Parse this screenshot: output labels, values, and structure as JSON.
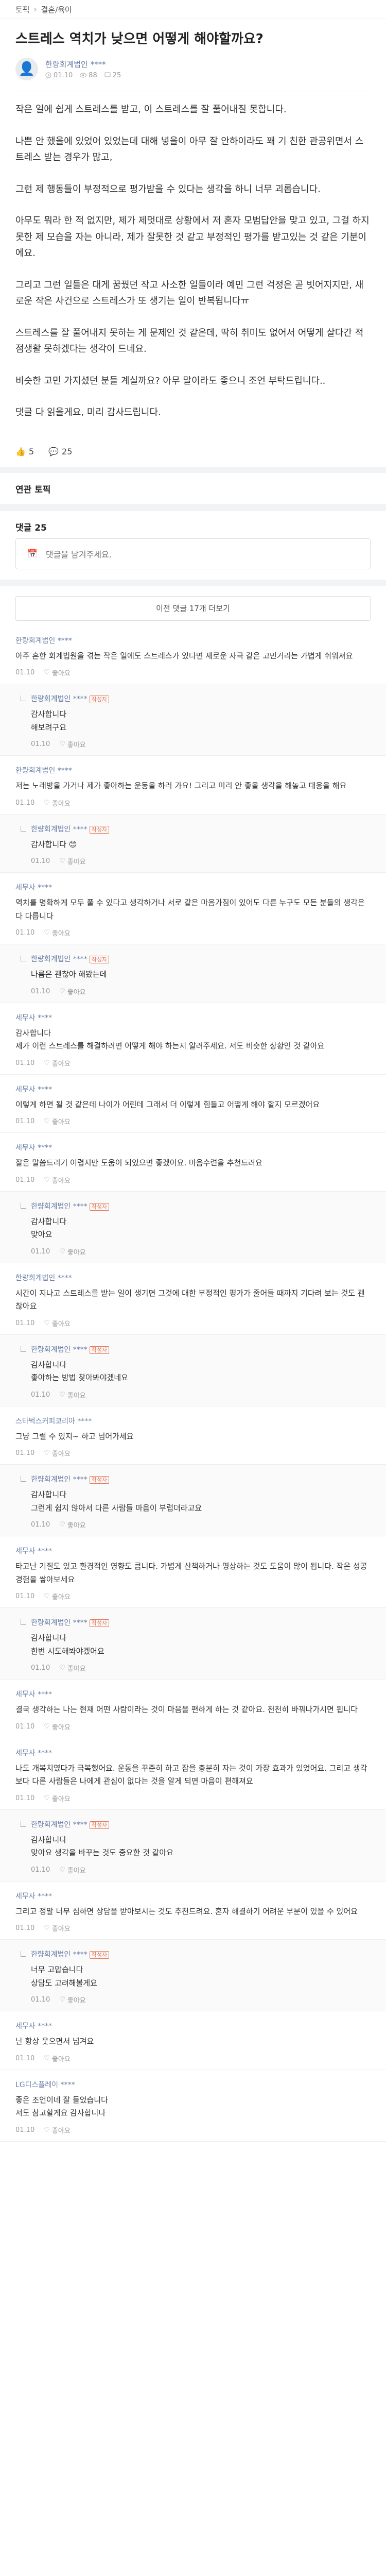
{
  "breadcrumb": [
    "토픽",
    "결혼/육아"
  ],
  "post": {
    "title": "스트레스 역치가 낮으면 어떻게 해야할까요?",
    "author": "한량회계법인 ****",
    "date": "01.10",
    "views": "88",
    "comments_count": "25",
    "body": [
      "작은 일에 쉽게 스트레스를 받고, 이 스트레스를 잘 풀어내질 못합니다.",
      "나쁜 안 했을에 있었어 있었는데 대해 넣을이 아무 잘 안하이라도 꽤 기 친한 관공위면서 스트레스 받는 경우가 많고,",
      "그런 제 행동들이 부정적으로 평가받을 수 있다는 생각을 하니 너무 괴롭습니다.",
      "아무도 뭐라 한 적 없지만, 제가 제멋대로 상황에서 저 혼자 모범답안을 맞고 있고, 그걸 하지 못한 제 모습을 자는 아니라, 제가 잘못한 것 같고 부정적인 평가를 받고있는 것 같은 기분이에요.",
      "그리고 그런 일들은 대게 꿈꿨던 작고 사소한 일들이라 예민 그런 걱정은 곧 빗어지지만, 새로운 작은 사건으로 스트레스가 또 생기는 일이 반복됩니다ㅠ",
      "스트레스를 잘 풀어내지 못하는 게 문제인 것 같은데, 딱히 취미도 없어서 어떻게 살다간 적점생활 못하겠다는 생각이 드네요.",
      "비슷한 고민 가지셨던 분들 계실까요? 아무 말이라도 좋으니 조언 부탁드립니다..",
      "댓글 다 읽을게요, 미리 감사드립니다."
    ],
    "likes": "5",
    "comments_label": "25"
  },
  "sections": {
    "related_label": "연관 토픽",
    "comments_header": "댓글 25",
    "comment_placeholder": "댓글을 남겨주세요.",
    "load_older": "이전 댓글 17개 더보기"
  },
  "comments": [
    {
      "name": "한량회계법인 ****",
      "badge": "",
      "reply": false,
      "text": "아주 흔한 회계법원을 겪는 작은 일에도 스트레스가 있다면 새로운 자극 같은 고민거리는 가볍게 쉬워져요",
      "date": "01.10",
      "likes": "좋아요"
    },
    {
      "name": "한량회계법인 ****",
      "badge": "작성자",
      "reply": true,
      "text": "감사합니다\n해보려구요",
      "date": "01.10",
      "likes": "좋아요"
    },
    {
      "name": "한량회계법인 ****",
      "badge": "",
      "reply": false,
      "text": "저는 노래방을 가거나 제가 좋아하는 운동을 하러 가요! 그리고 미리 안 좋을 생각을 해놓고 대응을 해요",
      "date": "01.10",
      "likes": "좋아요"
    },
    {
      "name": "한량회계법인 ****",
      "badge": "작성자",
      "reply": true,
      "text": "감사합니다 😊",
      "date": "01.10",
      "likes": "좋아요"
    },
    {
      "name": "세무사 ****",
      "badge": "",
      "reply": false,
      "text": "역치를 명확하게 모두 풀 수 있다고 생각하거나 서로 같은 마음가짐이 있어도 다른 누구도 모든 분들의 생각은 다 다릅니다",
      "date": "01.10",
      "likes": "좋아요"
    },
    {
      "name": "한량회계법인 ****",
      "badge": "작성자",
      "reply": true,
      "text": "나름은 괜찮아 해봤는데",
      "date": "01.10",
      "likes": "좋아요"
    },
    {
      "name": "세무사 ****",
      "badge": "",
      "reply": false,
      "text": "감사합니다\n제가 이런 스트레스를 해결하려면 어떻게 해야 하는지 알려주세요. 저도 비슷한 상황인 것 같아요",
      "date": "01.10",
      "likes": "좋아요"
    },
    {
      "name": "세무사 ****",
      "badge": "",
      "reply": false,
      "text": "이렇게 하면 될 것 같은데 나이가 어린데 그래서 더 이렇게 힘들고 어떻게 해야 할지 모르겠어요",
      "date": "01.10",
      "likes": "좋아요"
    },
    {
      "name": "세무사 ****",
      "badge": "",
      "reply": false,
      "text": "잘은 말씀드리기 어렵지만 도움이 되었으면 좋겠어요. 마음수련을 추천드려요",
      "date": "01.10",
      "likes": "좋아요"
    },
    {
      "name": "한량회계법인 ****",
      "badge": "작성자",
      "reply": true,
      "text": "감사합니다\n맞아요",
      "date": "01.10",
      "likes": "좋아요"
    },
    {
      "name": "한량회계법인 ****",
      "badge": "",
      "reply": false,
      "text": "시간이 지나고 스트레스를 받는 일이 생기면 그것에 대한 부정적인 평가가 줄어들 때까지 기다려 보는 것도 괜찮아요",
      "date": "01.10",
      "likes": "좋아요"
    },
    {
      "name": "한량회계법인 ****",
      "badge": "작성자",
      "reply": true,
      "text": "감사합니다\n좋아하는 방법 찾아봐야겠네요",
      "date": "01.10",
      "likes": "좋아요"
    },
    {
      "name": "스타벅스커피코리아 ****",
      "badge": "",
      "reply": false,
      "text": "그냥 그럴 수 있지~ 하고 넘어가세요",
      "date": "01.10",
      "likes": "좋아요"
    },
    {
      "name": "한량회계법인 ****",
      "badge": "작성자",
      "reply": true,
      "text": "감사합니다\n그런게 쉽지 않아서 다른 사람들 마음이 부럽더라고요",
      "date": "01.10",
      "likes": "좋아요"
    },
    {
      "name": "세무사 ****",
      "badge": "",
      "reply": false,
      "text": "타고난 기질도 있고 환경적인 영향도 큽니다. 가볍게 산책하거나 명상하는 것도 도움이 많이 됩니다. 작은 성공 경험을 쌓아보세요",
      "date": "01.10",
      "likes": "좋아요"
    },
    {
      "name": "한량회계법인 ****",
      "badge": "작성자",
      "reply": true,
      "text": "감사합니다\n한번 시도해봐야겠어요",
      "date": "01.10",
      "likes": "좋아요"
    },
    {
      "name": "세무사 ****",
      "badge": "",
      "reply": false,
      "text": "결국 생각하는 나는 현재 어떤 사람이라는 것이 마음을 편하게 하는 것 같아요. 천천히 바꿔나가시면 됩니다",
      "date": "01.10",
      "likes": "좋아요"
    },
    {
      "name": "세무사 ****",
      "badge": "",
      "reply": false,
      "text": "나도 개복치였다가 극복했어요. 운동을 꾸준히 하고 잠을 충분히 자는 것이 가장 효과가 있었어요. 그리고 생각보다 다른 사람들은 나에게 관심이 없다는 것을 알게 되면 마음이 편해져요",
      "date": "01.10",
      "likes": "좋아요"
    },
    {
      "name": "한량회계법인 ****",
      "badge": "작성자",
      "reply": true,
      "text": "감사합니다\n맞아요 생각을 바꾸는 것도 중요한 것 같아요",
      "date": "01.10",
      "likes": "좋아요"
    },
    {
      "name": "세무사 ****",
      "badge": "",
      "reply": false,
      "text": "그리고 정말 너무 심하면 상담을 받아보시는 것도 추천드려요. 혼자 해결하기 어려운 부분이 있을 수 있어요",
      "date": "01.10",
      "likes": "좋아요"
    },
    {
      "name": "한량회계법인 ****",
      "badge": "작성자",
      "reply": true,
      "text": "너무 고맙습니다\n상담도 고려해볼게요",
      "date": "01.10",
      "likes": "좋아요"
    },
    {
      "name": "세무사 ****",
      "badge": "",
      "reply": false,
      "text": "난 항상 웃으면서 넘겨요",
      "date": "01.10",
      "likes": "좋아요"
    },
    {
      "name": "LG디스플레이 ****",
      "badge": "",
      "reply": false,
      "text": "좋은 조언이네 잘 들었습니다\n저도 참고할게요 감사합니다",
      "date": "01.10",
      "likes": "좋아요"
    }
  ],
  "colors": {
    "accent": "#6a7fa8",
    "badge": "#e47b5a"
  }
}
